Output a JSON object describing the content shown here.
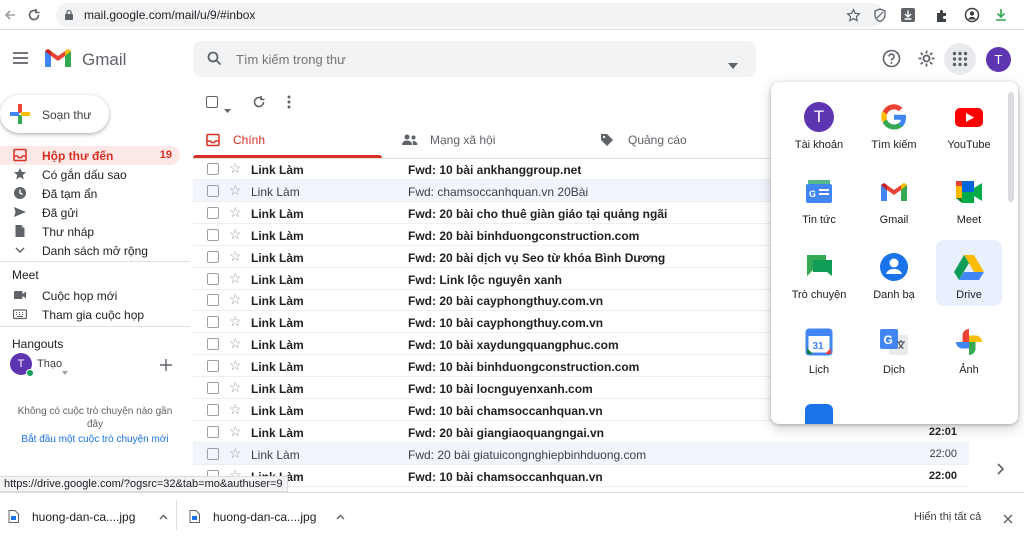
{
  "browser": {
    "url": "mail.google.com/mail/u/9/#inbox"
  },
  "header": {
    "logo_text": "Gmail",
    "search_placeholder": "Tìm kiếm trong thư",
    "avatar_letter": "T"
  },
  "sidebar": {
    "compose_label": "Soạn thư",
    "items": [
      {
        "label": "Hộp thư đến",
        "count": "19",
        "icon": "inbox-icon",
        "active": true
      },
      {
        "label": "Có gắn dấu sao",
        "icon": "star-icon"
      },
      {
        "label": "Đã tạm ẩn",
        "icon": "clock-icon"
      },
      {
        "label": "Đã gửi",
        "icon": "send-icon"
      },
      {
        "label": "Thư nháp",
        "icon": "draft-icon"
      },
      {
        "label": "Danh sách mở rộng",
        "icon": "chevron-down-icon"
      }
    ],
    "meet_title": "Meet",
    "meet_items": [
      {
        "label": "Cuộc họp mới",
        "icon": "video-icon"
      },
      {
        "label": "Tham gia cuộc họp",
        "icon": "keyboard-icon"
      }
    ],
    "hangouts_title": "Hangouts",
    "hangouts_user": "Thạo",
    "hangouts_avatar": "T",
    "hangouts_empty": "Không có cuộc trò chuyện nào gần đây",
    "hangouts_start": "Bắt đầu một cuộc trò chuyện mới"
  },
  "tabs": [
    {
      "label": "Chính",
      "active": true
    },
    {
      "label": "Mạng xã hội"
    },
    {
      "label": "Quảng cáo"
    }
  ],
  "emails": [
    {
      "sender": "Link Làm",
      "subject": "Fwd: 10 bài ankhanggroup.net",
      "time": "",
      "unread": true
    },
    {
      "sender": "Link Làm",
      "subject": "Fwd: chamsoccanhquan.vn 20Bài",
      "time": "",
      "unread": false
    },
    {
      "sender": "Link Làm",
      "subject": "Fwd: 20 bài cho thuê giàn giáo tại quảng ngãi",
      "time": "",
      "unread": true
    },
    {
      "sender": "Link Làm",
      "subject": "Fwd: 20 bài binhduongconstruction.com",
      "time": "",
      "unread": true
    },
    {
      "sender": "Link Làm",
      "subject": "Fwd: 20 bài dịch vụ Seo từ khóa Bình Dương",
      "time": "",
      "unread": true
    },
    {
      "sender": "Link Làm",
      "subject": "Fwd: Link lộc nguyên xanh",
      "time": "",
      "unread": true
    },
    {
      "sender": "Link Làm",
      "subject": "Fwd: 20 bài cayphongthuy.com.vn",
      "time": "",
      "unread": true
    },
    {
      "sender": "Link Làm",
      "subject": "Fwd: 10 bài cayphongthuy.com.vn",
      "time": "",
      "unread": true
    },
    {
      "sender": "Link Làm",
      "subject": "Fwd: 10 bài xaydungquangphuc.com",
      "time": "",
      "unread": true
    },
    {
      "sender": "Link Làm",
      "subject": "Fwd: 10 bài binhduongconstruction.com",
      "time": "",
      "unread": true
    },
    {
      "sender": "Link Làm",
      "subject": "Fwd: 10 bài locnguyenxanh.com",
      "time": "",
      "unread": true
    },
    {
      "sender": "Link Làm",
      "subject": "Fwd: 10 bài chamsoccanhquan.vn",
      "time": "",
      "unread": true
    },
    {
      "sender": "Link Làm",
      "subject": "Fwd: 20 bài giangiaoquangngai.vn",
      "time": "22:01",
      "unread": true
    },
    {
      "sender": "Link Làm",
      "subject": "Fwd: 20 bài giatuicongnghiepbinhduong.com",
      "time": "22:00",
      "unread": false
    },
    {
      "sender": "Link Làm",
      "subject": "Fwd: 10 bài chamsoccanhquan.vn",
      "time": "22:00",
      "unread": true
    }
  ],
  "apps": [
    {
      "label": "Tài khoản",
      "icon": "account-icon"
    },
    {
      "label": "Tìm kiếm",
      "icon": "google-search-icon"
    },
    {
      "label": "YouTube",
      "icon": "youtube-icon"
    },
    {
      "label": "Tin tức",
      "icon": "news-icon"
    },
    {
      "label": "Gmail",
      "icon": "gmail-icon"
    },
    {
      "label": "Meet",
      "icon": "meet-icon"
    },
    {
      "label": "Trò chuyện",
      "icon": "chat-icon"
    },
    {
      "label": "Danh bạ",
      "icon": "contacts-icon"
    },
    {
      "label": "Drive",
      "icon": "drive-icon",
      "highlighted": true
    },
    {
      "label": "Lịch",
      "icon": "calendar-icon"
    },
    {
      "label": "Dịch",
      "icon": "translate-icon"
    },
    {
      "label": "Ảnh",
      "icon": "photos-icon"
    }
  ],
  "app_icon_text": {
    "account": "T",
    "calendar": "31"
  },
  "status_url": "https://drive.google.com/?ogsrc=32&tab=mo&authuser=9",
  "downloads": [
    {
      "name": "huong-dan-ca....jpg"
    },
    {
      "name": "huong-dan-ca....jpg"
    }
  ],
  "downloads_show_all": "Hiển thị tất cả",
  "colors": {
    "gmail_red": "#d93025",
    "accent_blue": "#1a73e8",
    "avatar_purple": "#5e35b1"
  }
}
